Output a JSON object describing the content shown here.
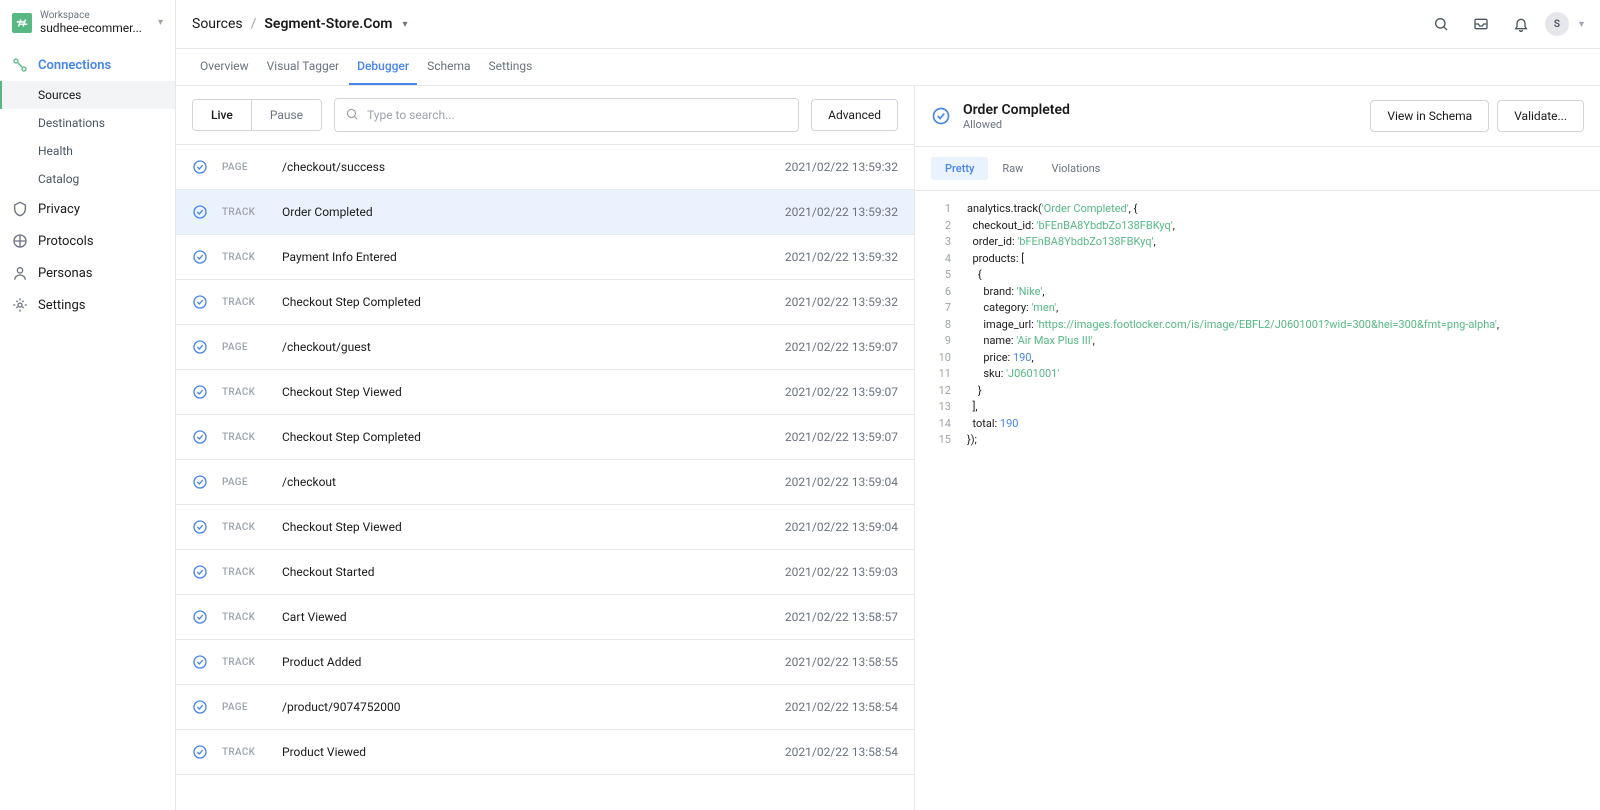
{
  "workspace": {
    "label": "Workspace",
    "name": "sudhee-ecommer..."
  },
  "nav": {
    "connections": "Connections",
    "items": {
      "sources": "Sources",
      "destinations": "Destinations",
      "health": "Health",
      "catalog": "Catalog"
    },
    "privacy": "Privacy",
    "protocols": "Protocols",
    "personas": "Personas",
    "settings": "Settings"
  },
  "breadcrumb": {
    "root": "Sources",
    "sep": "/",
    "current": "Segment-Store.Com"
  },
  "avatar": "S",
  "tabs": {
    "overview": "Overview",
    "visual_tagger": "Visual Tagger",
    "debugger": "Debugger",
    "schema": "Schema",
    "settings": "Settings"
  },
  "controls": {
    "live": "Live",
    "pause": "Pause",
    "search_placeholder": "Type to search...",
    "advanced": "Advanced"
  },
  "events": [
    {
      "type": "PAGE",
      "name": "/checkout/success",
      "time": "2021/02/22 13:59:32",
      "selected": false
    },
    {
      "type": "TRACK",
      "name": "Order Completed",
      "time": "2021/02/22 13:59:32",
      "selected": true
    },
    {
      "type": "TRACK",
      "name": "Payment Info Entered",
      "time": "2021/02/22 13:59:32",
      "selected": false
    },
    {
      "type": "TRACK",
      "name": "Checkout Step Completed",
      "time": "2021/02/22 13:59:32",
      "selected": false
    },
    {
      "type": "PAGE",
      "name": "/checkout/guest",
      "time": "2021/02/22 13:59:07",
      "selected": false
    },
    {
      "type": "TRACK",
      "name": "Checkout Step Viewed",
      "time": "2021/02/22 13:59:07",
      "selected": false
    },
    {
      "type": "TRACK",
      "name": "Checkout Step Completed",
      "time": "2021/02/22 13:59:07",
      "selected": false
    },
    {
      "type": "PAGE",
      "name": "/checkout",
      "time": "2021/02/22 13:59:04",
      "selected": false
    },
    {
      "type": "TRACK",
      "name": "Checkout Step Viewed",
      "time": "2021/02/22 13:59:04",
      "selected": false
    },
    {
      "type": "TRACK",
      "name": "Checkout Started",
      "time": "2021/02/22 13:59:03",
      "selected": false
    },
    {
      "type": "TRACK",
      "name": "Cart Viewed",
      "time": "2021/02/22 13:58:57",
      "selected": false
    },
    {
      "type": "TRACK",
      "name": "Product Added",
      "time": "2021/02/22 13:58:55",
      "selected": false
    },
    {
      "type": "PAGE",
      "name": "/product/9074752000",
      "time": "2021/02/22 13:58:54",
      "selected": false
    },
    {
      "type": "TRACK",
      "name": "Product Viewed",
      "time": "2021/02/22 13:58:54",
      "selected": false
    }
  ],
  "detail": {
    "title": "Order Completed",
    "sub": "Allowed",
    "view_in_schema": "View in Schema",
    "validate": "Validate...",
    "tabs": {
      "pretty": "Pretty",
      "raw": "Raw",
      "violations": "Violations"
    },
    "code": [
      [
        {
          "t": "key",
          "v": "analytics.track("
        },
        {
          "t": "str",
          "v": "'Order Completed'"
        },
        {
          "t": "punc",
          "v": ", {"
        }
      ],
      [
        {
          "t": "punc",
          "v": "  "
        },
        {
          "t": "key",
          "v": "checkout_id: "
        },
        {
          "t": "str",
          "v": "'bFEnBA8YbdbZo138FBKyq'"
        },
        {
          "t": "punc",
          "v": ","
        }
      ],
      [
        {
          "t": "punc",
          "v": "  "
        },
        {
          "t": "key",
          "v": "order_id: "
        },
        {
          "t": "str",
          "v": "'bFEnBA8YbdbZo138FBKyq'"
        },
        {
          "t": "punc",
          "v": ","
        }
      ],
      [
        {
          "t": "punc",
          "v": "  "
        },
        {
          "t": "key",
          "v": "products: "
        },
        {
          "t": "punc",
          "v": "["
        }
      ],
      [
        {
          "t": "punc",
          "v": "    {"
        }
      ],
      [
        {
          "t": "punc",
          "v": "      "
        },
        {
          "t": "key",
          "v": "brand: "
        },
        {
          "t": "str",
          "v": "'Nike'"
        },
        {
          "t": "punc",
          "v": ","
        }
      ],
      [
        {
          "t": "punc",
          "v": "      "
        },
        {
          "t": "key",
          "v": "category: "
        },
        {
          "t": "str",
          "v": "'men'"
        },
        {
          "t": "punc",
          "v": ","
        }
      ],
      [
        {
          "t": "punc",
          "v": "      "
        },
        {
          "t": "key",
          "v": "image_url: "
        },
        {
          "t": "str",
          "v": "'https://images.footlocker.com/is/image/EBFL2/J0601001?wid=300&hei=300&fmt=png-alpha'"
        },
        {
          "t": "punc",
          "v": ","
        }
      ],
      [
        {
          "t": "punc",
          "v": "      "
        },
        {
          "t": "key",
          "v": "name: "
        },
        {
          "t": "str",
          "v": "'Air Max Plus III'"
        },
        {
          "t": "punc",
          "v": ","
        }
      ],
      [
        {
          "t": "punc",
          "v": "      "
        },
        {
          "t": "key",
          "v": "price: "
        },
        {
          "t": "num",
          "v": "190"
        },
        {
          "t": "punc",
          "v": ","
        }
      ],
      [
        {
          "t": "punc",
          "v": "      "
        },
        {
          "t": "key",
          "v": "sku: "
        },
        {
          "t": "str",
          "v": "'J0601001'"
        }
      ],
      [
        {
          "t": "punc",
          "v": "    }"
        }
      ],
      [
        {
          "t": "punc",
          "v": "  ],"
        }
      ],
      [
        {
          "t": "punc",
          "v": "  "
        },
        {
          "t": "key",
          "v": "total: "
        },
        {
          "t": "num",
          "v": "190"
        }
      ],
      [
        {
          "t": "punc",
          "v": "});"
        }
      ]
    ]
  }
}
